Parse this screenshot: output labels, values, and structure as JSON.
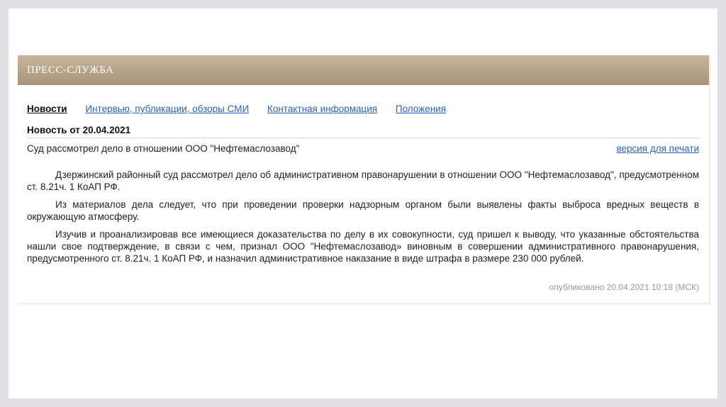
{
  "header": {
    "title": "ПРЕСС-СЛУЖБА"
  },
  "nav": [
    {
      "label": "Новости",
      "active": true
    },
    {
      "label": "Интервью, публикации, обзоры СМИ"
    },
    {
      "label": "Контактная информация"
    },
    {
      "label": "Положения"
    }
  ],
  "news": {
    "date_heading": "Новость от 20.04.2021",
    "title": "Суд рассмотрел дело в отношении ООО \"Нефтемаслозавод\"",
    "print_link": "версия для печати",
    "paragraphs": [
      "Дзержинский районный суд рассмотрел дело об административном правонарушении в отношении ООО \"Нефтемаслозавод\", предусмотренном ст. 8.21ч. 1 КоАП РФ.",
      "Из материалов дела следует, что при проведении проверки надзорным органом были выявлены факты выброса вредных веществ в окружающую атмосферу.",
      "Изучив и проанализировав все имеющиеся доказательства по делу в их совокупности, суд пришел к выводу, что указанные обстоятельства нашли свое подтверждение, в связи с чем, признал ООО \"Нефтемаслозавод» виновным в совершении административного правонарушения, предусмотренного ст. 8.21ч. 1 КоАП РФ, и назначил административное наказание в виде штрафа в размере 230 000 рублей."
    ],
    "published": "опубликовано 20.04.2021 10:18 (МСК)"
  }
}
